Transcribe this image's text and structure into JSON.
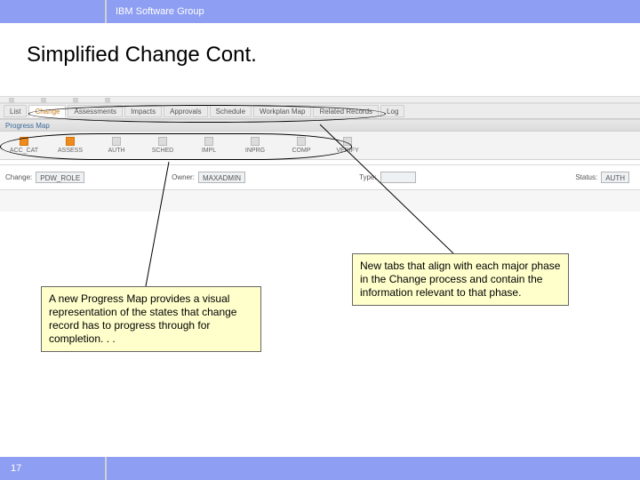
{
  "header": {
    "group": "IBM Software Group"
  },
  "slide": {
    "title": "Simplified Change Cont.",
    "page_number": "17"
  },
  "tabs": [
    "List",
    "Change",
    "Assessments",
    "Impacts",
    "Approvals",
    "Schedule",
    "Workplan Map",
    "Related Records",
    "Log"
  ],
  "tabs_active_index": 1,
  "progress_map": {
    "label": "Progress Map",
    "steps": [
      "ACC_CAT",
      "ASSESS",
      "AUTH",
      "SCHED",
      "IMPL",
      "INPRG",
      "COMP",
      "VERIFY"
    ],
    "done_steps": [
      0,
      1
    ]
  },
  "fields": {
    "change_label": "Change:",
    "change_value": "PDW_ROLE",
    "owner_label": "Owner:",
    "owner_value": "MAXADMIN",
    "type_label": "Type:",
    "type_value": "",
    "status_label": "Status:",
    "status_value": "AUTH"
  },
  "callouts": {
    "left": "A new Progress Map provides a visual representation of the states that change record has to progress through for completion. . .",
    "right": "New tabs that align with each major phase in the Change process and contain the information relevant to that phase."
  }
}
